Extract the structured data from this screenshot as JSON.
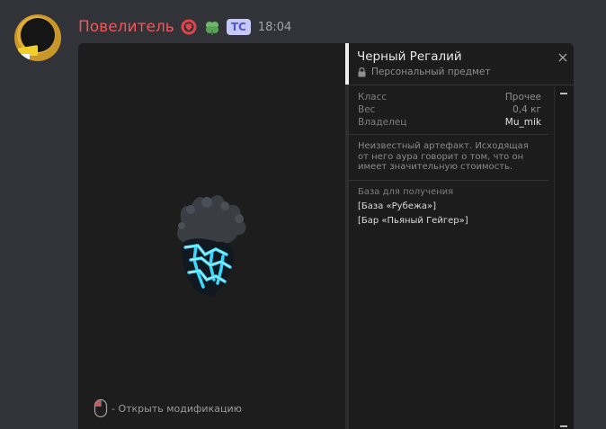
{
  "message": {
    "username": "Повелитель",
    "tag": "ТС",
    "time": "18:04",
    "role_icons": [
      "shield-badge-icon",
      "clover-badge-icon"
    ]
  },
  "item": {
    "name": "Черный Регалий",
    "subtitle": "Персональный предмет",
    "properties": [
      {
        "label": "Класс",
        "value": "Прочее"
      },
      {
        "label": "Вес",
        "value": "0,4 кг"
      },
      {
        "label": "Владелец",
        "value": "Mu_mik"
      }
    ],
    "description": "Неизвестный артефакт. Исходящая от него аура говорит о том, что он имеет значительную стоимость.",
    "bases_title": "База для получения",
    "bases": [
      "[База «Рубежа»]",
      "[Бар «Пьяный Гейгер»]"
    ]
  },
  "preview": {
    "hint": "- Открыть модификацию"
  },
  "colors": {
    "username": "#f0575b",
    "background": "#313338",
    "artifact_glow": "#38d8ff"
  }
}
